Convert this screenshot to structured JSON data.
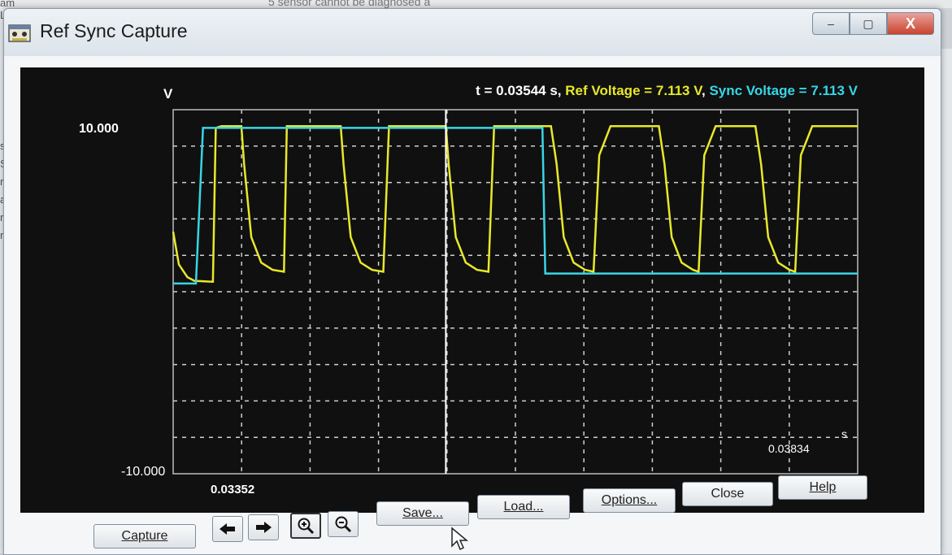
{
  "background": {
    "top_text": "5 sensor cannot be diagnosed a",
    "left_fragments": [
      "am Limit",
      "s",
      "Sc",
      "rn",
      "ar",
      "rn",
      "rnb"
    ]
  },
  "window": {
    "title": "Ref Sync Capture",
    "controls": {
      "minimize": "–",
      "maximize": "▢",
      "close": "X"
    }
  },
  "readout": {
    "time_text": "t = 0.03544 s, ",
    "ref_text": "Ref Voltage =  7.113 V",
    "separator": ", ",
    "sync_text": "Sync Voltage =  7.113 V"
  },
  "chart_data": {
    "type": "line",
    "y_unit_label": "V",
    "x_unit_label": "s",
    "y_max_label": "10.000",
    "y_min_label": "-10.000",
    "x_min_label": "0.03352",
    "x_max_label": "0.03834",
    "xlim": [
      0.03352,
      0.03834
    ],
    "ylim": [
      -10,
      10
    ],
    "grid": true,
    "cursor_x": 0.03544,
    "colors": {
      "ref": "#e8e82a",
      "sync": "#38d6e6",
      "cursor": "#ffffff",
      "grid": "#cfcfcf",
      "text": "#ffffff"
    },
    "series": [
      {
        "key": "ref",
        "points": [
          [
            0.03352,
            3.3
          ],
          [
            0.03356,
            1.5
          ],
          [
            0.03362,
            0.8
          ],
          [
            0.03367,
            0.6
          ],
          [
            0.0338,
            0.55
          ],
          [
            0.03382,
            9.0
          ],
          [
            0.03386,
            9.1
          ],
          [
            0.034,
            9.1
          ],
          [
            0.03402,
            7.0
          ],
          [
            0.03407,
            3.0
          ],
          [
            0.03414,
            1.6
          ],
          [
            0.03422,
            1.2
          ],
          [
            0.0343,
            1.1
          ],
          [
            0.03432,
            9.1
          ],
          [
            0.0347,
            9.1
          ],
          [
            0.03472,
            7.0
          ],
          [
            0.03477,
            3.0
          ],
          [
            0.03484,
            1.6
          ],
          [
            0.03492,
            1.2
          ],
          [
            0.035,
            1.1
          ],
          [
            0.03504,
            9.1
          ],
          [
            0.03542,
            9.1
          ],
          [
            0.03544,
            9.1
          ],
          [
            0.03546,
            7.0
          ],
          [
            0.03551,
            3.0
          ],
          [
            0.03558,
            1.6
          ],
          [
            0.03566,
            1.2
          ],
          [
            0.03574,
            1.1
          ],
          [
            0.03578,
            9.1
          ],
          [
            0.03618,
            9.1
          ],
          [
            0.03622,
            7.0
          ],
          [
            0.03627,
            3.0
          ],
          [
            0.03634,
            1.6
          ],
          [
            0.03642,
            1.2
          ],
          [
            0.03648,
            1.1
          ],
          [
            0.03652,
            7.5
          ],
          [
            0.0366,
            9.1
          ],
          [
            0.03694,
            9.1
          ],
          [
            0.03698,
            7.0
          ],
          [
            0.03703,
            3.0
          ],
          [
            0.0371,
            1.6
          ],
          [
            0.03718,
            1.2
          ],
          [
            0.03722,
            1.1
          ],
          [
            0.03726,
            7.5
          ],
          [
            0.03734,
            9.1
          ],
          [
            0.03762,
            9.1
          ],
          [
            0.03766,
            7.0
          ],
          [
            0.03771,
            3.0
          ],
          [
            0.03778,
            1.6
          ],
          [
            0.03786,
            1.2
          ],
          [
            0.0379,
            1.1
          ],
          [
            0.03794,
            7.5
          ],
          [
            0.03802,
            9.1
          ],
          [
            0.03834,
            9.1
          ]
        ]
      },
      {
        "key": "sync",
        "points": [
          [
            0.03352,
            0.45
          ],
          [
            0.03368,
            0.45
          ],
          [
            0.03373,
            9.0
          ],
          [
            0.03612,
            9.0
          ],
          [
            0.03614,
            1.0
          ],
          [
            0.03834,
            1.0
          ]
        ]
      }
    ]
  },
  "buttons": {
    "capture": "Capture",
    "save": "Save...",
    "load": "Load...",
    "options": "Options...",
    "close": "Close",
    "help": "Help"
  },
  "nav_icons": {
    "prev": "arrow-left-icon",
    "next": "arrow-right-icon",
    "zoom_in": "zoom-in-icon",
    "zoom_out": "zoom-out-icon"
  }
}
